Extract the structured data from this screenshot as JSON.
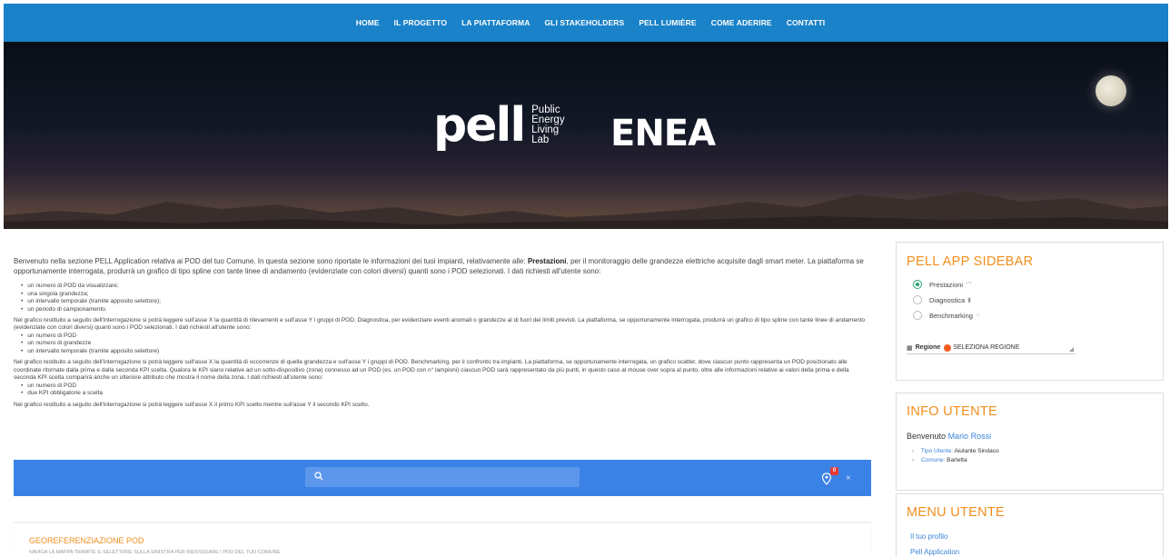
{
  "nav": {
    "items": [
      "HOME",
      "IL PROGETTO",
      "LA PIATTAFORMA",
      "GLI STAKEHOLDERS",
      "PELL LUMIÈRE",
      "COME ADERIRE",
      "CONTATTI"
    ]
  },
  "hero": {
    "pell_word": "pell",
    "pell_sub": [
      "Public",
      "Energy",
      "Living",
      "Lab"
    ],
    "enea": "ENEA"
  },
  "intro": {
    "text_before": "Benvenuto nella sezione PELL Application relativa ai POD del tuo Comune. In questa sezione sono riportate le informazioni dei tuoi impianti, relativamente alle: ",
    "bold": "Prestazioni",
    "text_after": ", per il monitoraggio delle grandezze elettriche acquisite dagli smart meter. La piattaforma se opportunamente interrogata, produrrà un grafico di tipo spline con tante linee di andamento (evidenziate con colori diversi) quanti sono i POD selezionati. I dati richiesti all'utente sono:"
  },
  "list1": [
    "un numero di POD da visualizzare;",
    "una singola grandezza;",
    "un intervallo temporale (tramite apposito selettore);",
    "un periodo di campionamento."
  ],
  "para1": "Nel grafico restituito a seguito dell'interrogazione si potrà leggere sull'asse X la quantità di rilevamenti e sull'asse Y i gruppi di POD. Diagnostica, per evidenziare eventi anomali o grandezze al di fuori dei limiti previsti. La piattaforma, se opportunamente interrogata, produrrà un grafico di tipo spline con tante linee di andamento (evidenziate con colori diversi) quanti sono i POD selezionati. I dati richiesti all'utente sono:",
  "list2": [
    "un numero di POD",
    "un numero di grandezze",
    "un intervallo temporale (tramite apposito selettore)"
  ],
  "para2": "Nel grafico restituito a seguito dell'interrogazione si potrà leggere sull'asse X la quantità di occorrenze di quella grandezza e sull'asse Y i gruppi di POD. Benchmarking, per il confronto tra impianti. La piattaforma, se opportunamente interrogata, un grafico scatter, dove ciascun punto rappresenta un POD posizionato alle coordinate ritornate dalla prima e dalla seconda KPI scelta. Qualora le KPI siano relative ad un sotto-dispositivo (zona) connesso ad un POD (es. un POD con n° lampioni) ciascun POD sarà rappresentato da più punti, in questo caso al mouse over sopra al punto, oltre alle informazioni relative ai valori della prima e della seconda KPI scelta comparirà anche un ulteriore attributo che mostra il nome della zona. I dati richiesti all'utente sono:",
  "list3": [
    "un numero di POD",
    "due KPI obbligatorie a scelta"
  ],
  "para3": "Nel grafico restituito a seguito dell'interrogazione si potrà leggere sull'asse X il primo KPI scelto mentre sull'asse Y il secondo KPI scelto.",
  "map": {
    "search_placeholder": "",
    "badge_count": "0",
    "close": "×"
  },
  "geo": {
    "title": "GEOREFERENZIAZIONE POD",
    "subtitle": "NAVIGA LA MAPPA TRAMITE IL SELETTORE SULLA SINISTRA PER INDIVIDUARE I POD DEL TUO COMUNE"
  },
  "sidebar": {
    "title": "PELL APP SIDEBAR",
    "options": [
      {
        "label": "Prestazioni",
        "icon": "⌒",
        "selected": true
      },
      {
        "label": "Diagnostica",
        "icon": "▮",
        "selected": false
      },
      {
        "label": "Benchmarking",
        "icon": "⁘",
        "selected": false
      }
    ],
    "region_label": "Regione",
    "region_value": "SELEZIONA REGIONE"
  },
  "info": {
    "title": "INFO UTENTE",
    "welcome": "Benvenuto",
    "user_name": "Mario Rossi",
    "role_key": "Tipo Utente:",
    "role_val": "Aiutante Sindaco",
    "city_key": "Comune:",
    "city_val": "Barletta"
  },
  "menu": {
    "title": "MENU UTENTE",
    "links": [
      "Il tuo profilo",
      "Pell Application"
    ]
  },
  "colors": {
    "nav_bg": "#1a82c8",
    "accent_orange": "#f28e1c",
    "map_bar": "#3b82e6",
    "link_blue": "#3a85d8",
    "radio_green": "#23a66a"
  }
}
